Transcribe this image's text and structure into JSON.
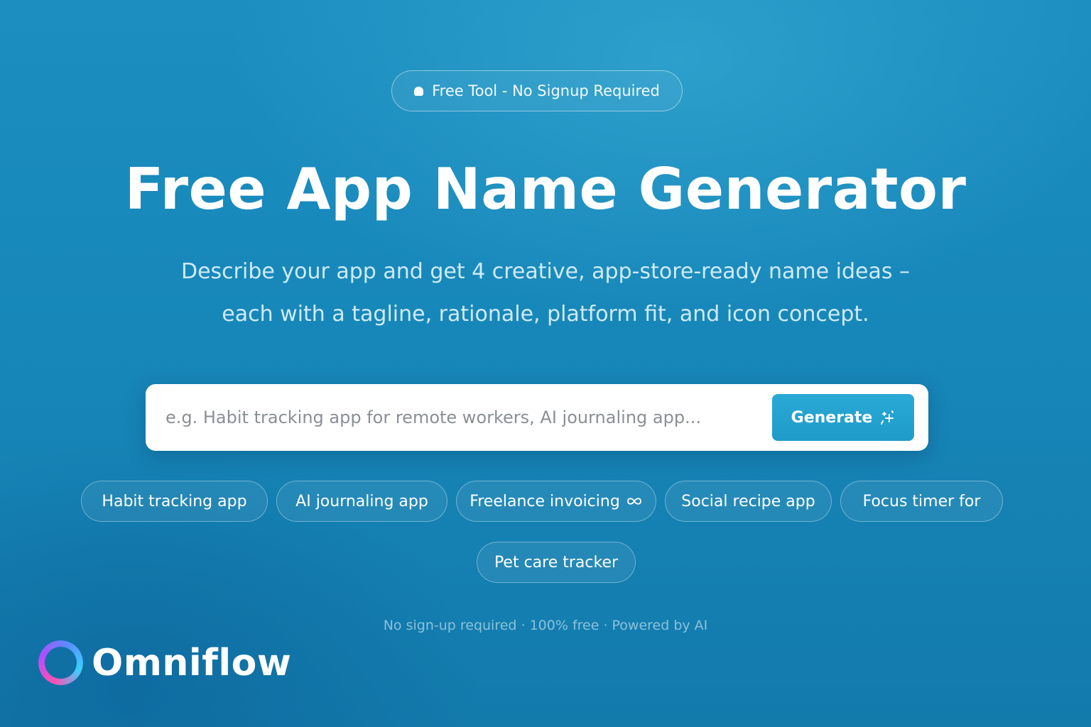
{
  "badge": {
    "text": "Free Tool - No Signup Required"
  },
  "hero": {
    "title": "Free App Name Generator",
    "subtitle_line1": "Describe your app and get 4 creative, app-store-ready name ideas –",
    "subtitle_line2": "each with a tagline, rationale, platform fit, and icon concept."
  },
  "search": {
    "placeholder": "e.g. Habit tracking app for remote workers, AI journaling app...",
    "value": "",
    "button_label": "Generate",
    "button_icon": "sparkle-icon"
  },
  "suggestions": [
    {
      "label": "Habit tracking app"
    },
    {
      "label": "AI journaling app"
    },
    {
      "label": "Freelance invoicing",
      "icon": "infinity-icon"
    },
    {
      "label": "Social recipe app"
    },
    {
      "label": "Focus timer for"
    },
    {
      "label": "Pet care tracker"
    }
  ],
  "footnote": "No sign-up required · 100% free · Powered by AI",
  "brand": {
    "name": "Omniflow"
  },
  "colors": {
    "background": "#1787b9",
    "accent_button": "#22a3d0",
    "text_primary": "#ffffff"
  }
}
